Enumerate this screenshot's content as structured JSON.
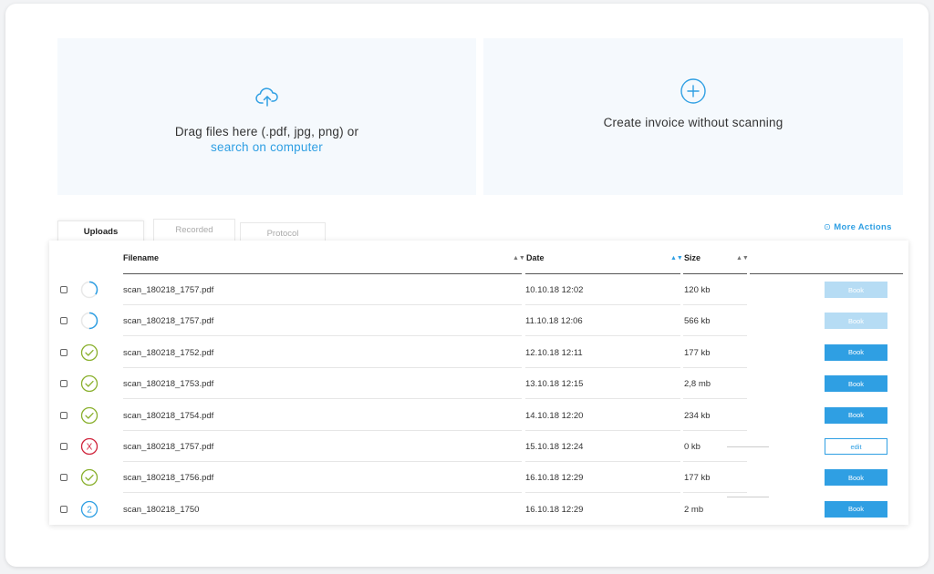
{
  "upload_zone": {
    "text": "Drag files here (.pdf, jpg, png) or",
    "link": "search on computer",
    "icon": "cloud-upload-icon"
  },
  "create_zone": {
    "text": "Create invoice without scanning",
    "icon": "plus-circle-icon"
  },
  "tabs": [
    "Uploads",
    "Recorded",
    "Protocol"
  ],
  "active_tab": "Uploads",
  "more_actions": "More Actions",
  "columns": {
    "filename": "Filename",
    "date": "Date",
    "size": "Size"
  },
  "colors": {
    "accent": "#2f9fe3",
    "success": "#8ab02e",
    "error": "#d0243c",
    "disabled": "#b6dcf4"
  },
  "rows": [
    {
      "status": "loading",
      "progress": 0.35,
      "filename": "scan_180218_1757.pdf",
      "date": "10.10.18 12:02",
      "size": "120 kb",
      "action": "Book",
      "action_state": "disabled"
    },
    {
      "status": "loading",
      "progress": 0.5,
      "filename": "scan_180218_1757.pdf",
      "date": "11.10.18 12:06",
      "size": "566 kb",
      "action": "Book",
      "action_state": "disabled"
    },
    {
      "status": "success",
      "filename": "scan_180218_1752.pdf",
      "date": "12.10.18 12:11",
      "size": "177 kb",
      "action": "Book",
      "action_state": "enabled"
    },
    {
      "status": "success",
      "filename": "scan_180218_1753.pdf",
      "date": "13.10.18 12:15",
      "size": "2,8 mb",
      "action": "Book",
      "action_state": "enabled"
    },
    {
      "status": "success",
      "filename": "scan_180218_1754.pdf",
      "date": "14.10.18 12:20",
      "size": "234 kb",
      "action": "Book",
      "action_state": "enabled"
    },
    {
      "status": "error",
      "status_text": "X",
      "filename": "scan_180218_1757.pdf",
      "date": "15.10.18 12:24",
      "size": "0 kb",
      "action": "edit",
      "action_state": "outline"
    },
    {
      "status": "success",
      "filename": "scan_180218_1756.pdf",
      "date": "16.10.18 12:29",
      "size": "177 kb",
      "action": "Book",
      "action_state": "enabled"
    },
    {
      "status": "count",
      "status_text": "2",
      "filename": "scan_180218_1750",
      "date": "16.10.18 12:29",
      "size": "2 mb",
      "action": "Book",
      "action_state": "enabled"
    }
  ]
}
